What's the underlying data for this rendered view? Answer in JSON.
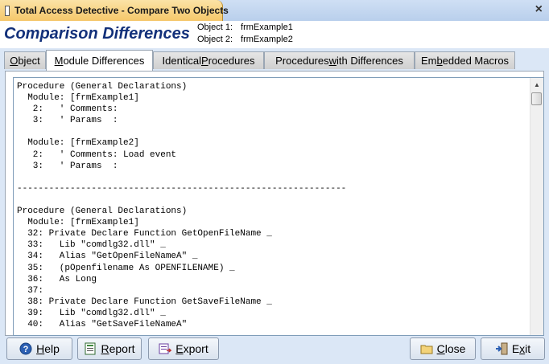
{
  "window": {
    "title": "Total Access Detective - Compare Two Objects"
  },
  "header": {
    "title": "Comparison Differences",
    "object1_label": "Object 1:",
    "object1_value": "frmExample1",
    "object2_label": "Object 2:",
    "object2_value": "frmExample2"
  },
  "tabs": [
    {
      "label_pre": "",
      "label_key": "O",
      "label_post": "bject"
    },
    {
      "label_pre": "",
      "label_key": "M",
      "label_post": "odule Differences"
    },
    {
      "label_pre": "Identical ",
      "label_key": "P",
      "label_post": "rocedures"
    },
    {
      "label_pre": "Procedures ",
      "label_key": "w",
      "label_post": "ith Differences"
    },
    {
      "label_pre": "Em",
      "label_key": "b",
      "label_post": "edded Macros"
    }
  ],
  "active_tab": "Module Differences",
  "code_text": "Procedure (General Declarations)\n  Module: [frmExample1]\n   2:   ' Comments:\n   3:   ' Params  :\n\n  Module: [frmExample2]\n   2:   ' Comments: Load event\n   3:   ' Params  :\n\n--------------------------------------------------------------\n\nProcedure (General Declarations)\n  Module: [frmExample1]\n  32: Private Declare Function GetOpenFileName _\n  33:   Lib \"comdlg32.dll\" _\n  34:   Alias \"GetOpenFileNameA\" _\n  35:   (pOpenfilename As OPENFILENAME) _\n  36:   As Long\n  37:\n  38: Private Declare Function GetSaveFileName _\n  39:   Lib \"comdlg32.dll\" _\n  40:   Alias \"GetSaveFileNameA\"",
  "buttons": {
    "help": {
      "key": "H",
      "rest": "elp"
    },
    "report": {
      "key": "R",
      "rest": "eport"
    },
    "export": {
      "key": "E",
      "rest": "xport"
    },
    "close": {
      "key": "C",
      "rest": "lose"
    },
    "exit": {
      "pre": "E",
      "key": "x",
      "rest": "it"
    }
  },
  "colors": {
    "header_title": "#12307a",
    "title_tab": "#f5c76a",
    "background": "#dbe7f6"
  }
}
